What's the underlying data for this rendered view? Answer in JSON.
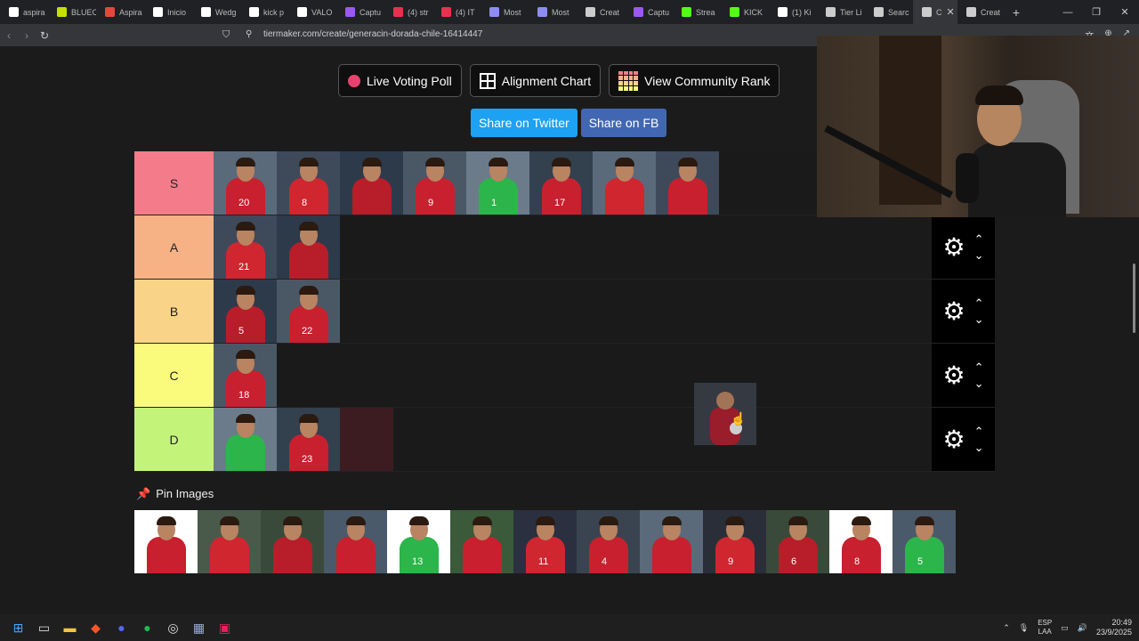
{
  "browser": {
    "tabs": [
      {
        "label": "aspira",
        "color": "#ffffff"
      },
      {
        "label": "BLUEC",
        "color": "#c6e000"
      },
      {
        "label": "Aspira",
        "color": "#e04a3b"
      },
      {
        "label": "Inicio",
        "color": "#ffffff"
      },
      {
        "label": "Wedg",
        "color": "#ffffff"
      },
      {
        "label": "kick p",
        "color": "#ffffff"
      },
      {
        "label": "VALO",
        "color": "#ffffff"
      },
      {
        "label": "Captu",
        "color": "#9b59f0"
      },
      {
        "label": "(4) str",
        "color": "#e8314f"
      },
      {
        "label": "(4) IT",
        "color": "#e8314f"
      },
      {
        "label": "Most",
        "color": "#8f8cf0"
      },
      {
        "label": "Most",
        "color": "#8f8cf0"
      },
      {
        "label": "Creat",
        "color": "#cccccc"
      },
      {
        "label": "Captu",
        "color": "#9b59f0"
      },
      {
        "label": "Strea",
        "color": "#53fc18"
      },
      {
        "label": "KICK",
        "color": "#53fc18"
      },
      {
        "label": "(1) Ki",
        "color": "#ffffff"
      },
      {
        "label": "Tier Li",
        "color": "#cccccc"
      },
      {
        "label": "Searc",
        "color": "#cccccc"
      },
      {
        "label": "C",
        "color": "#cccccc",
        "active": true
      },
      {
        "label": "Creat",
        "color": "#cccccc"
      }
    ],
    "new_tab": "+",
    "url": "tiermaker.com/create/generacin-dorada-chile-16414447"
  },
  "actions": {
    "live_voting": "Live Voting Poll",
    "alignment": "Alignment Chart",
    "community": "View Community Rank",
    "share_twitter": "Share on Twitter",
    "share_fb": "Share on FB"
  },
  "tiers": [
    {
      "label": "S",
      "color": "#f47c8a",
      "items": [
        "20",
        "8",
        "",
        "9",
        "1",
        "17",
        "",
        ""
      ]
    },
    {
      "label": "A",
      "color": "#f6b185",
      "items": [
        "21",
        ""
      ]
    },
    {
      "label": "B",
      "color": "#f9d387",
      "items": [
        "5",
        "22"
      ]
    },
    {
      "label": "C",
      "color": "#fafb7d",
      "items": [
        "18"
      ]
    },
    {
      "label": "D",
      "color": "#c4f37a",
      "items": [
        "",
        "23"
      ]
    }
  ],
  "pin": {
    "title": "Pin Images",
    "items": [
      "",
      "",
      "",
      "",
      "13",
      "",
      "11",
      "4",
      "",
      "9",
      "6",
      "8",
      "5"
    ]
  },
  "taskbar": {
    "lang_top": "ESP",
    "lang_bottom": "LAA",
    "time": "20:49",
    "date": "23/9/2025"
  }
}
